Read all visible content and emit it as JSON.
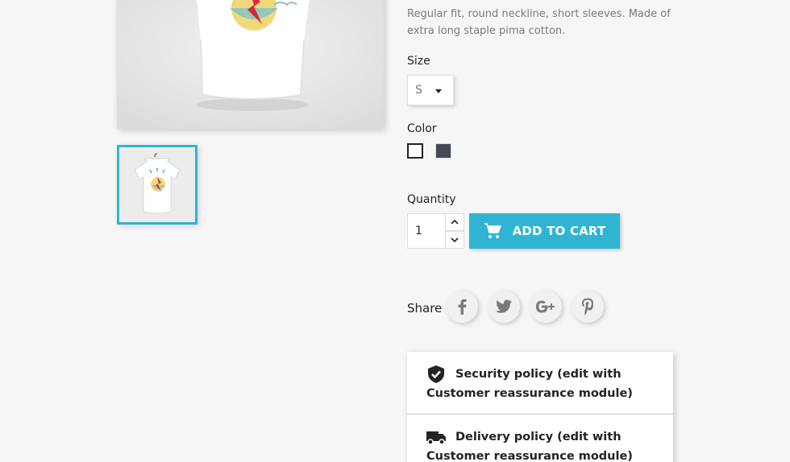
{
  "product": {
    "description": "Regular fit, round neckline, short sleeves. Made of extra long staple pima cotton.",
    "image_icon": "tshirt-image",
    "thumbnail_icon": "tshirt-thumbnail"
  },
  "size": {
    "label": "Size",
    "selected": "S"
  },
  "color": {
    "label": "Color",
    "options": [
      {
        "name": "white",
        "hex": "#ffffff",
        "selected": true
      },
      {
        "name": "dark-gray",
        "hex": "#434a54",
        "selected": false
      }
    ]
  },
  "quantity": {
    "label": "Quantity",
    "value": "1"
  },
  "cart": {
    "button_label": "ADD TO CART",
    "icon": "shopping-cart-icon"
  },
  "share": {
    "label": "Share",
    "networks": [
      "facebook",
      "twitter",
      "google-plus",
      "pinterest"
    ]
  },
  "reassurance": {
    "security": "Security policy (edit with Customer reassurance module)",
    "delivery": "Delivery policy (edit with Customer reassurance module)"
  },
  "colors": {
    "accent": "#2fb5d2",
    "text": "#232323",
    "muted": "#7a7a7a"
  }
}
